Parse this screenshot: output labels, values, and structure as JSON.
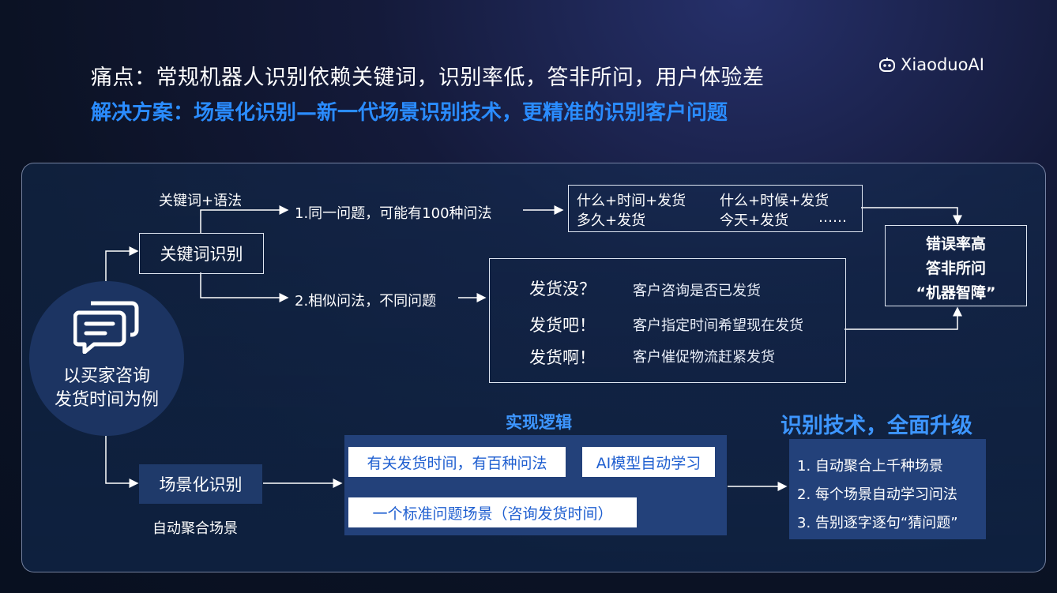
{
  "header": {
    "pain_point": "痛点：常规机器人识别依赖关键词，识别率低，答非所问，用户体验差",
    "solution": "解决方案：场景化识别—新一代场景识别技术，更精准的识别客户问题",
    "logo_text": "XiaoduoAI",
    "logo_icon": "robot-face-icon"
  },
  "left": {
    "example_line1": "以买家咨询",
    "example_line2": "发货时间为例",
    "icon": "chat-bubbles-icon"
  },
  "keyword": {
    "method_label": "关键词+语法",
    "box_label": "关键词识别",
    "issue1": "1.同一问题，可能有100种问法",
    "issue2": "2.相似问法，不同问题",
    "phrases": [
      "什么+时间+发货",
      "什么+时候+发货",
      "多久+发货",
      "今天+发货",
      "……"
    ],
    "similar": [
      {
        "q": "发货没？",
        "desc": "客户咨询是否已发货"
      },
      {
        "q": "发货吧！",
        "desc": "客户指定时间希望现在发货"
      },
      {
        "q": "发货啊！",
        "desc": "客户催促物流赶紧发货"
      }
    ],
    "result_line1": "错误率高",
    "result_line2": "答非所问",
    "result_line3": "“机器智障”"
  },
  "scene": {
    "box_label": "场景化识别",
    "sub_label": "自动聚合场景",
    "logic_title": "实现逻辑",
    "step1": "有关发货时间，有百种问法",
    "step2": "AI模型自动学习",
    "step3": "一个标准问题场景（咨询发货时间）",
    "upgrade_title": "识别技术，全面升级",
    "upgrades": [
      "1. 自动聚合上千种场景",
      "2. 每个场景自动学习问法",
      "3. 告别逐字逐句“猜问题”"
    ]
  },
  "colors": {
    "accent_blue": "#2a8cff",
    "panel_blue": "#23417a",
    "step_text": "#1f5fd0"
  }
}
